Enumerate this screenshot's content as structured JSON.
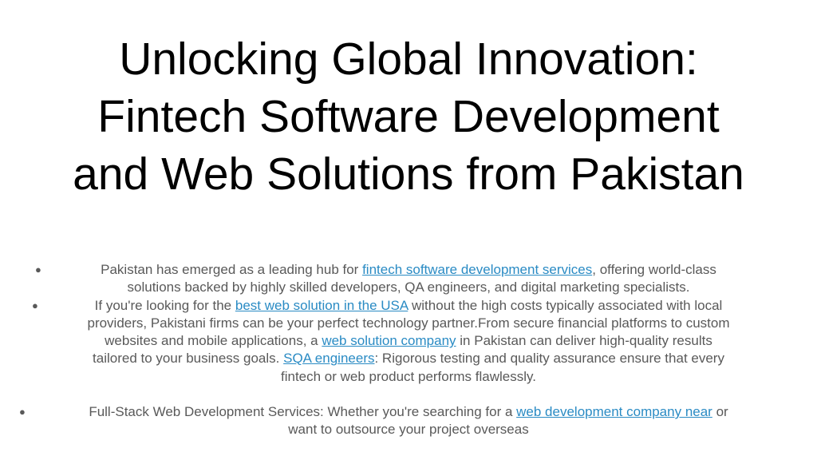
{
  "title": {
    "line1": "Unlocking Global Innovation:",
    "line2": "Fintech Software Development",
    "line3": "and Web Solutions from Pakistan"
  },
  "bullet_symbol": "●",
  "bullets": [
    {
      "l1_pre": "Pakistan has emerged as a leading hub for ",
      "l1_link": "fintech software development services",
      "l1_post": ", offering world-class",
      "l2": "solutions backed by highly skilled developers, QA engineers, and digital marketing specialists."
    },
    {
      "l1_pre": "If you're looking for the  ",
      "l1_link": "best web solution in the USA",
      "l1_post": " without the high costs typically associated with local",
      "l2": "providers, Pakistani firms can be your perfect technology partner.From secure financial platforms to custom",
      "l3_pre": "websites and mobile applications, a ",
      "l3_link": "web solution company",
      "l3_post": " in Pakistan can deliver high-quality results",
      "l4_pre": "tailored to your business goals. ",
      "l4_link": "SQA engineers",
      "l4_post": ": Rigorous testing and quality assurance ensure that every",
      "l5": "fintech or web product performs flawlessly."
    },
    {
      "l1_pre": "Full-Stack Web Development Services: Whether you're searching for a  ",
      "l1_link": "web development company near",
      "l1_post": " or",
      "l2": "want to outsource your project overseas"
    }
  ],
  "colors": {
    "title": "#000000",
    "body_text": "#595959",
    "link": "#2a8bc4"
  }
}
